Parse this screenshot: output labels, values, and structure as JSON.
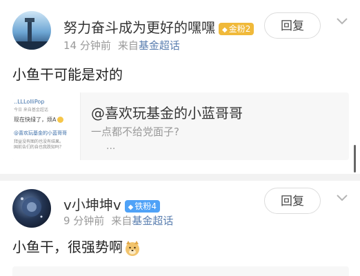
{
  "posts": [
    {
      "username": "努力奋斗成为更好的嘿嘿",
      "badge": {
        "icon": "diamond-icon",
        "label": "金粉2",
        "color": "#f0b93a"
      },
      "time": "14 分钟前",
      "from_prefix": "来自",
      "source": "基金超话",
      "reply_label": "回复",
      "content": "小鱼干可能是对的",
      "quote": {
        "thumb_lines": [
          "..LLLolliPop",
          "今日 来自基金超话",
          "现在快绿了，烦A",
          "@喜欢玩基金的小蓝哥哥",
          "拜益没有图的也没有结果。",
          "国前告们的自也我跌知吗？"
        ],
        "title": "@喜欢玩基金的小蓝哥哥",
        "subtitle": "一点都不给党面子?",
        "more": "..."
      }
    },
    {
      "username": "v小坤坤v",
      "badge": {
        "icon": "diamond-icon",
        "label": "铁粉4",
        "color": "#4fa2f7"
      },
      "time": "9 分钟前",
      "from_prefix": "来自",
      "source": "基金超话",
      "reply_label": "回复",
      "content": "小鱼干，很强势啊",
      "emoji": "doge-emoji-icon"
    }
  ],
  "colors": {
    "link": "#5b7fb0",
    "meta": "#999999",
    "separator": "#f2f2f2"
  }
}
